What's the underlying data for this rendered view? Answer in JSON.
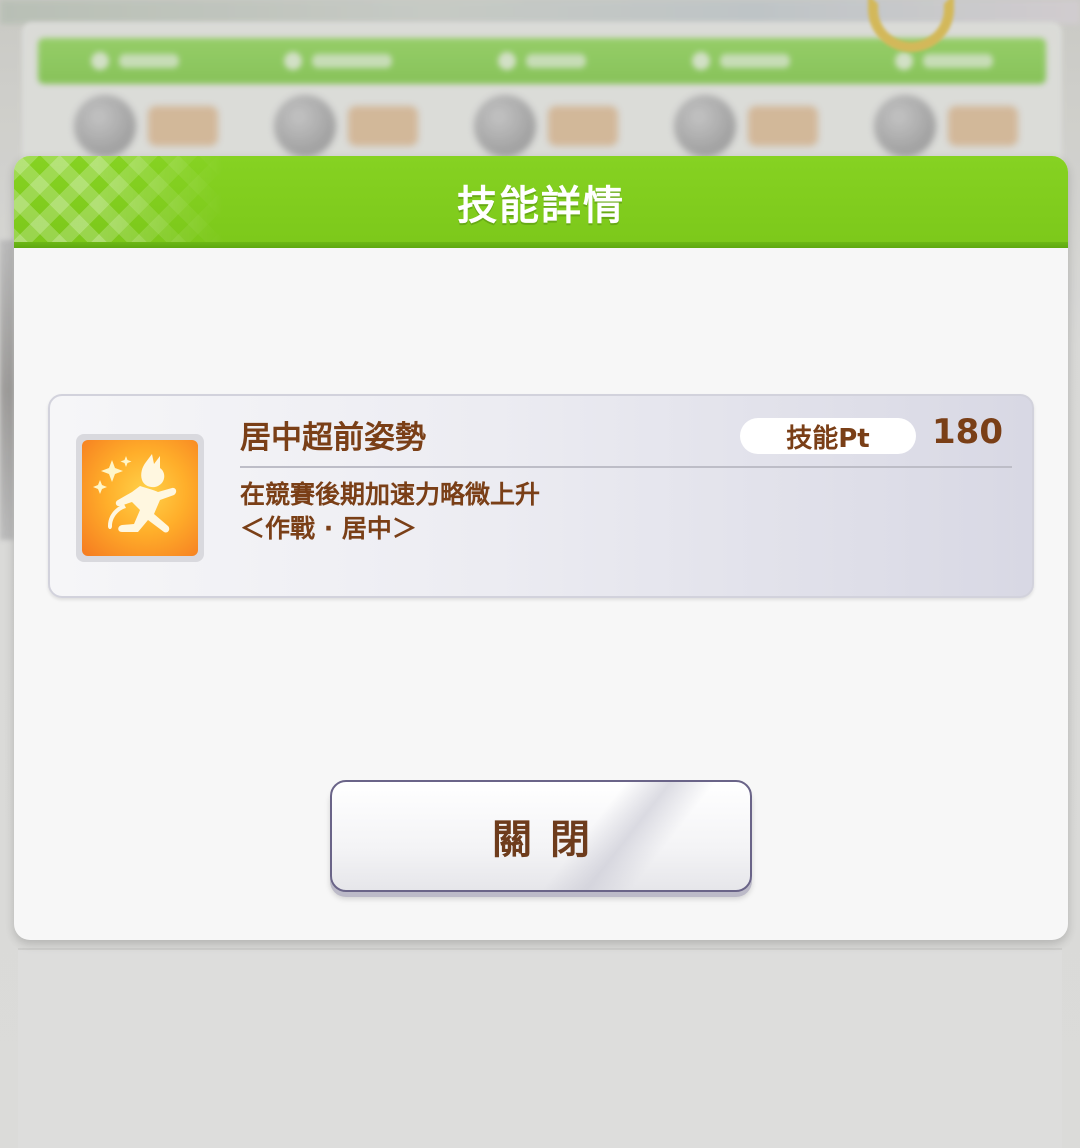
{
  "background": {
    "tabs": [
      "",
      "",
      "",
      "",
      ""
    ],
    "stats": [
      "",
      "",
      "",
      "",
      ""
    ]
  },
  "dialog": {
    "title": "技能詳情",
    "skill": {
      "name": "居中超前姿勢",
      "pt_label": "技能Pt",
      "pt_value": "180",
      "description": "在競賽後期加速力略微上升",
      "condition": "＜作戰 · 居中＞",
      "icon": "running-figure-icon"
    },
    "close_label": "關閉"
  },
  "colors": {
    "header_green": "#7cc81a",
    "text_brown": "#7a3f17",
    "icon_orange": "#ffae2a"
  }
}
